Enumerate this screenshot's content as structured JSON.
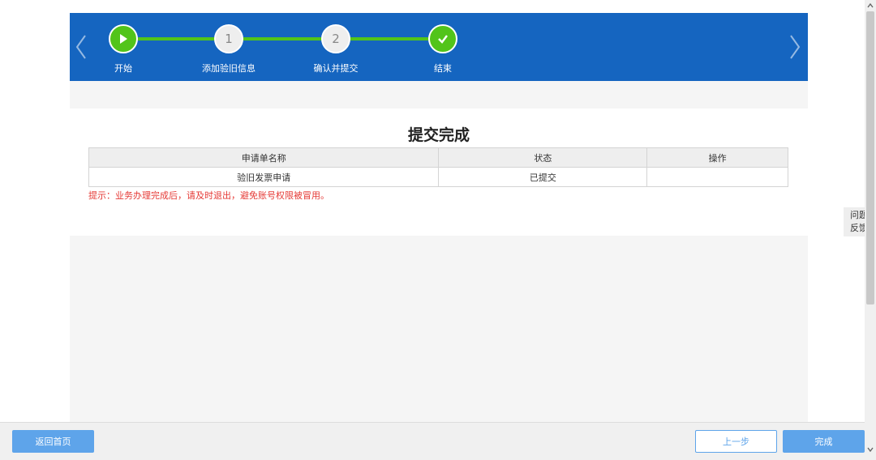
{
  "steps": [
    {
      "label": "开始",
      "state": "done",
      "icon": "play-icon"
    },
    {
      "label": "添加验旧信息",
      "state": "number",
      "number": "1"
    },
    {
      "label": "确认并提交",
      "state": "number",
      "number": "2"
    },
    {
      "label": "结束",
      "state": "done",
      "icon": "check-icon"
    }
  ],
  "panel": {
    "title": "提交完成",
    "table": {
      "headers": [
        "申请单名称",
        "状态",
        "操作"
      ],
      "rows": [
        [
          "验旧发票申请",
          "已提交",
          ""
        ]
      ]
    },
    "tip": "提示：业务办理完成后，请及时退出，避免账号权限被冒用。"
  },
  "feedback": {
    "line1": "问题",
    "line2": "反馈"
  },
  "buttons": {
    "home": "返回首页",
    "prev": "上一步",
    "finish": "完成"
  },
  "colors": {
    "header_bg": "#1565c0",
    "step_done": "#52c41a",
    "button_primary": "#5ea4ea",
    "tip_text": "#e53935"
  }
}
